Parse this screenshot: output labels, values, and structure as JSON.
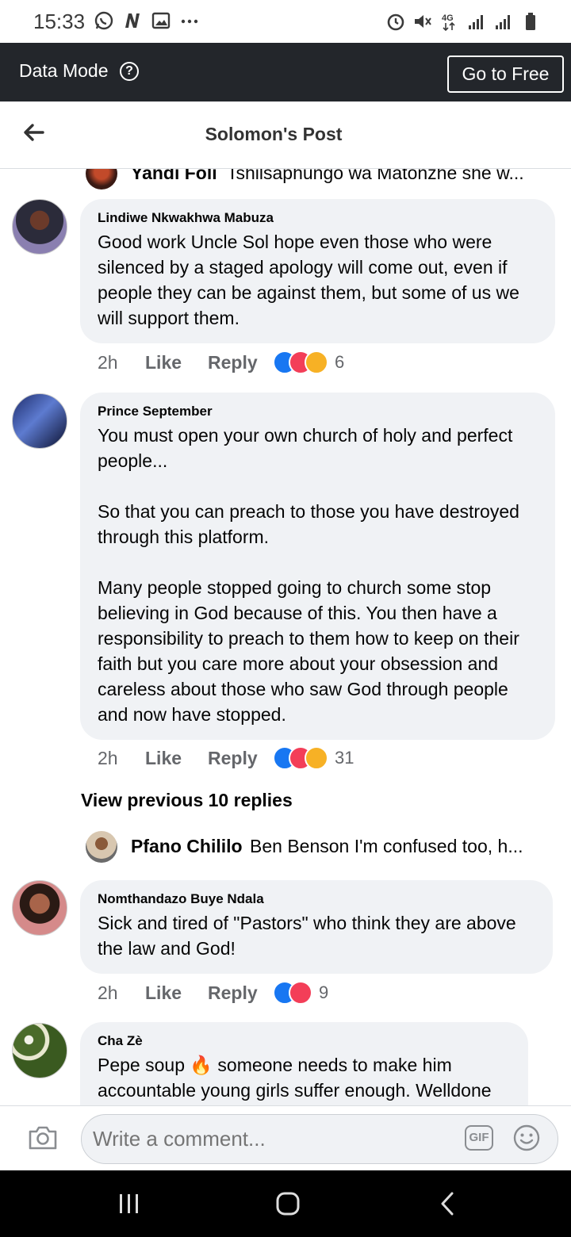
{
  "status_bar": {
    "time": "15:33",
    "left_icons": [
      "whatsapp-icon",
      "n-app-icon",
      "gallery-icon",
      "more-dots-icon"
    ],
    "right_icons": [
      "alarm-icon",
      "mute-icon",
      "4g-icon",
      "signal-icon",
      "signal-icon-2",
      "battery-icon"
    ],
    "network": "4G"
  },
  "data_bar": {
    "mode_label": "Data Mode",
    "help_symbol": "?",
    "go_free_label": "Go to Free"
  },
  "header": {
    "title": "Solomon's Post"
  },
  "collapsed_top": {
    "name": "Yandi Foli",
    "text": "Tshilsaphungo wa Matonzhe she w..."
  },
  "comments": [
    {
      "author": "Lindiwe Nkwakhwa Mabuza",
      "paragraphs": [
        "Good work Uncle Sol hope even those who were silenced by a staged apology will come out, even if people they can be against them, but some of us we will support them."
      ],
      "time": "2h",
      "like_label": "Like",
      "reply_label": "Reply",
      "reaction_count": "6"
    },
    {
      "author": "Prince September",
      "paragraphs": [
        "You must open your own church of holy and perfect people...",
        "So that you can preach to those you have destroyed through this platform.",
        "Many people stopped going to church some stop believing in God because of this. You then have a responsibility to preach to them how to keep on their faith but you care more about your obsession and careless about those who saw God through people and now have stopped."
      ],
      "time": "2h",
      "like_label": "Like",
      "reply_label": "Reply",
      "reaction_count": "31"
    },
    {
      "author": "Nomthandazo Buye Ndala",
      "paragraphs": [
        "Sick and tired of \"Pastors\" who think they are above the law and God!"
      ],
      "time": "2h",
      "like_label": "Like",
      "reply_label": "Reply",
      "reaction_count": "9"
    },
    {
      "author": "Cha Zè",
      "paragraphs": [
        "Pepe soup 🔥 someone needs to make him accountable young girls suffer enough. Welldone"
      ]
    }
  ],
  "view_previous": "View previous 10 replies",
  "collapsed_mid": {
    "name": "Pfano Chililo",
    "text": "Ben Benson I'm confused too, h..."
  },
  "comment_bar": {
    "placeholder": "Write a comment...",
    "gif_label": "GIF"
  },
  "colors": {
    "data_bar_bg": "#23262b",
    "bubble_bg": "#f0f2f5",
    "like_blue": "#1877f2",
    "love_red": "#f33e58",
    "meta_gray": "#65676b"
  }
}
